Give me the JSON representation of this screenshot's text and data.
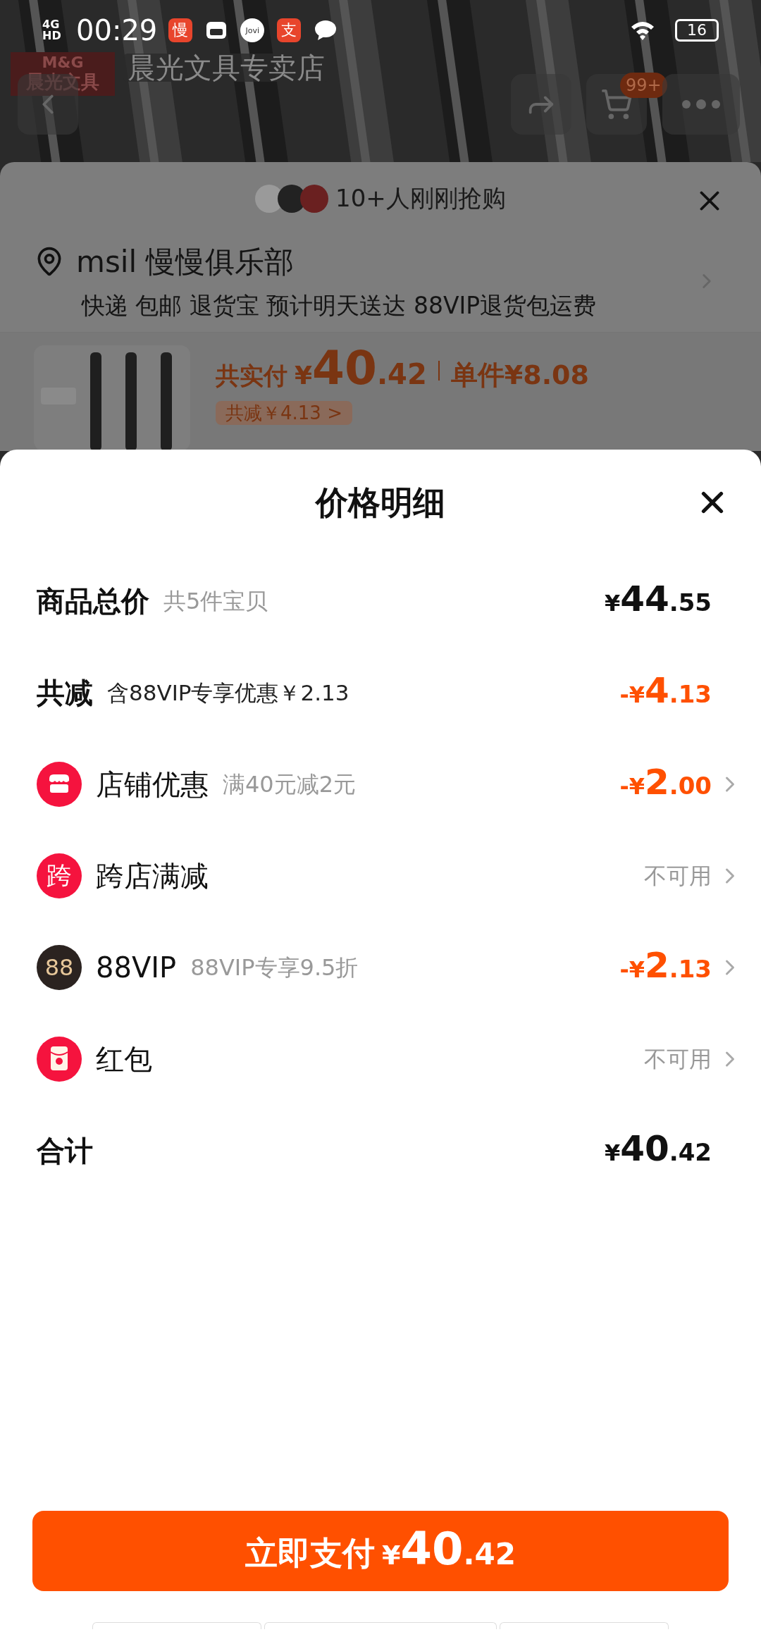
{
  "status_bar": {
    "network": "4G HD",
    "time": "00:29",
    "notifications": [
      {
        "kind": "badge",
        "glyph": "慢"
      },
      {
        "kind": "tv"
      },
      {
        "kind": "round",
        "glyph": "Jovi"
      },
      {
        "kind": "badge",
        "glyph": "支"
      },
      {
        "kind": "chat"
      }
    ],
    "battery": "16"
  },
  "header": {
    "logo_top": "M&G",
    "logo_text": "晨光文具",
    "store_name": "晨光文具专卖店",
    "cart_badge": "99+"
  },
  "order_sheet": {
    "buyers": "10+人刚刚抢购",
    "address_name": "msil 慢慢俱乐部",
    "delivery": "快递 包邮 退货宝 预计明天送达 88VIP退货包运费",
    "price": {
      "label": "共实付",
      "currency": "¥",
      "integer": "40",
      "decimal": ".42",
      "unit": "单件¥8.08"
    },
    "saving_badge": "共减￥4.13 >"
  },
  "price_detail": {
    "title": "价格明细",
    "rows": [
      {
        "kind": "summary",
        "label": "商品总价",
        "note": "共5件宝贝",
        "amount": {
          "currency": "¥",
          "integer": "44",
          "decimal": ".55"
        },
        "chevron": false
      },
      {
        "kind": "summary",
        "label": "共减",
        "note": "含88VIP专享优惠￥2.13",
        "amount": {
          "sign": "-",
          "currency": "¥",
          "integer": "4",
          "decimal": ".13"
        },
        "chevron": false
      },
      {
        "kind": "shop",
        "label": "店铺优惠",
        "note": "满40元减2元",
        "amount": {
          "sign": "-",
          "currency": "¥",
          "integer": "2",
          "decimal": ".00"
        },
        "chevron": true
      },
      {
        "kind": "cross-store",
        "icon_text": "跨",
        "label": "跨店满减",
        "status": "不可用",
        "chevron": true
      },
      {
        "kind": "vip",
        "icon_text": "88",
        "label": "88VIP",
        "note": "88VIP专享9.5折",
        "amount": {
          "sign": "-",
          "currency": "¥",
          "integer": "2",
          "decimal": ".13"
        },
        "chevron": true
      },
      {
        "kind": "envelope",
        "label": "红包",
        "status": "不可用",
        "chevron": true
      },
      {
        "kind": "summary",
        "label": "合计",
        "amount": {
          "currency": "¥",
          "integer": "40",
          "decimal": ".42"
        },
        "chevron": false
      }
    ],
    "pay_button": {
      "label": "立即支付",
      "currency": "¥",
      "integer": "40",
      "decimal": ".42"
    }
  }
}
